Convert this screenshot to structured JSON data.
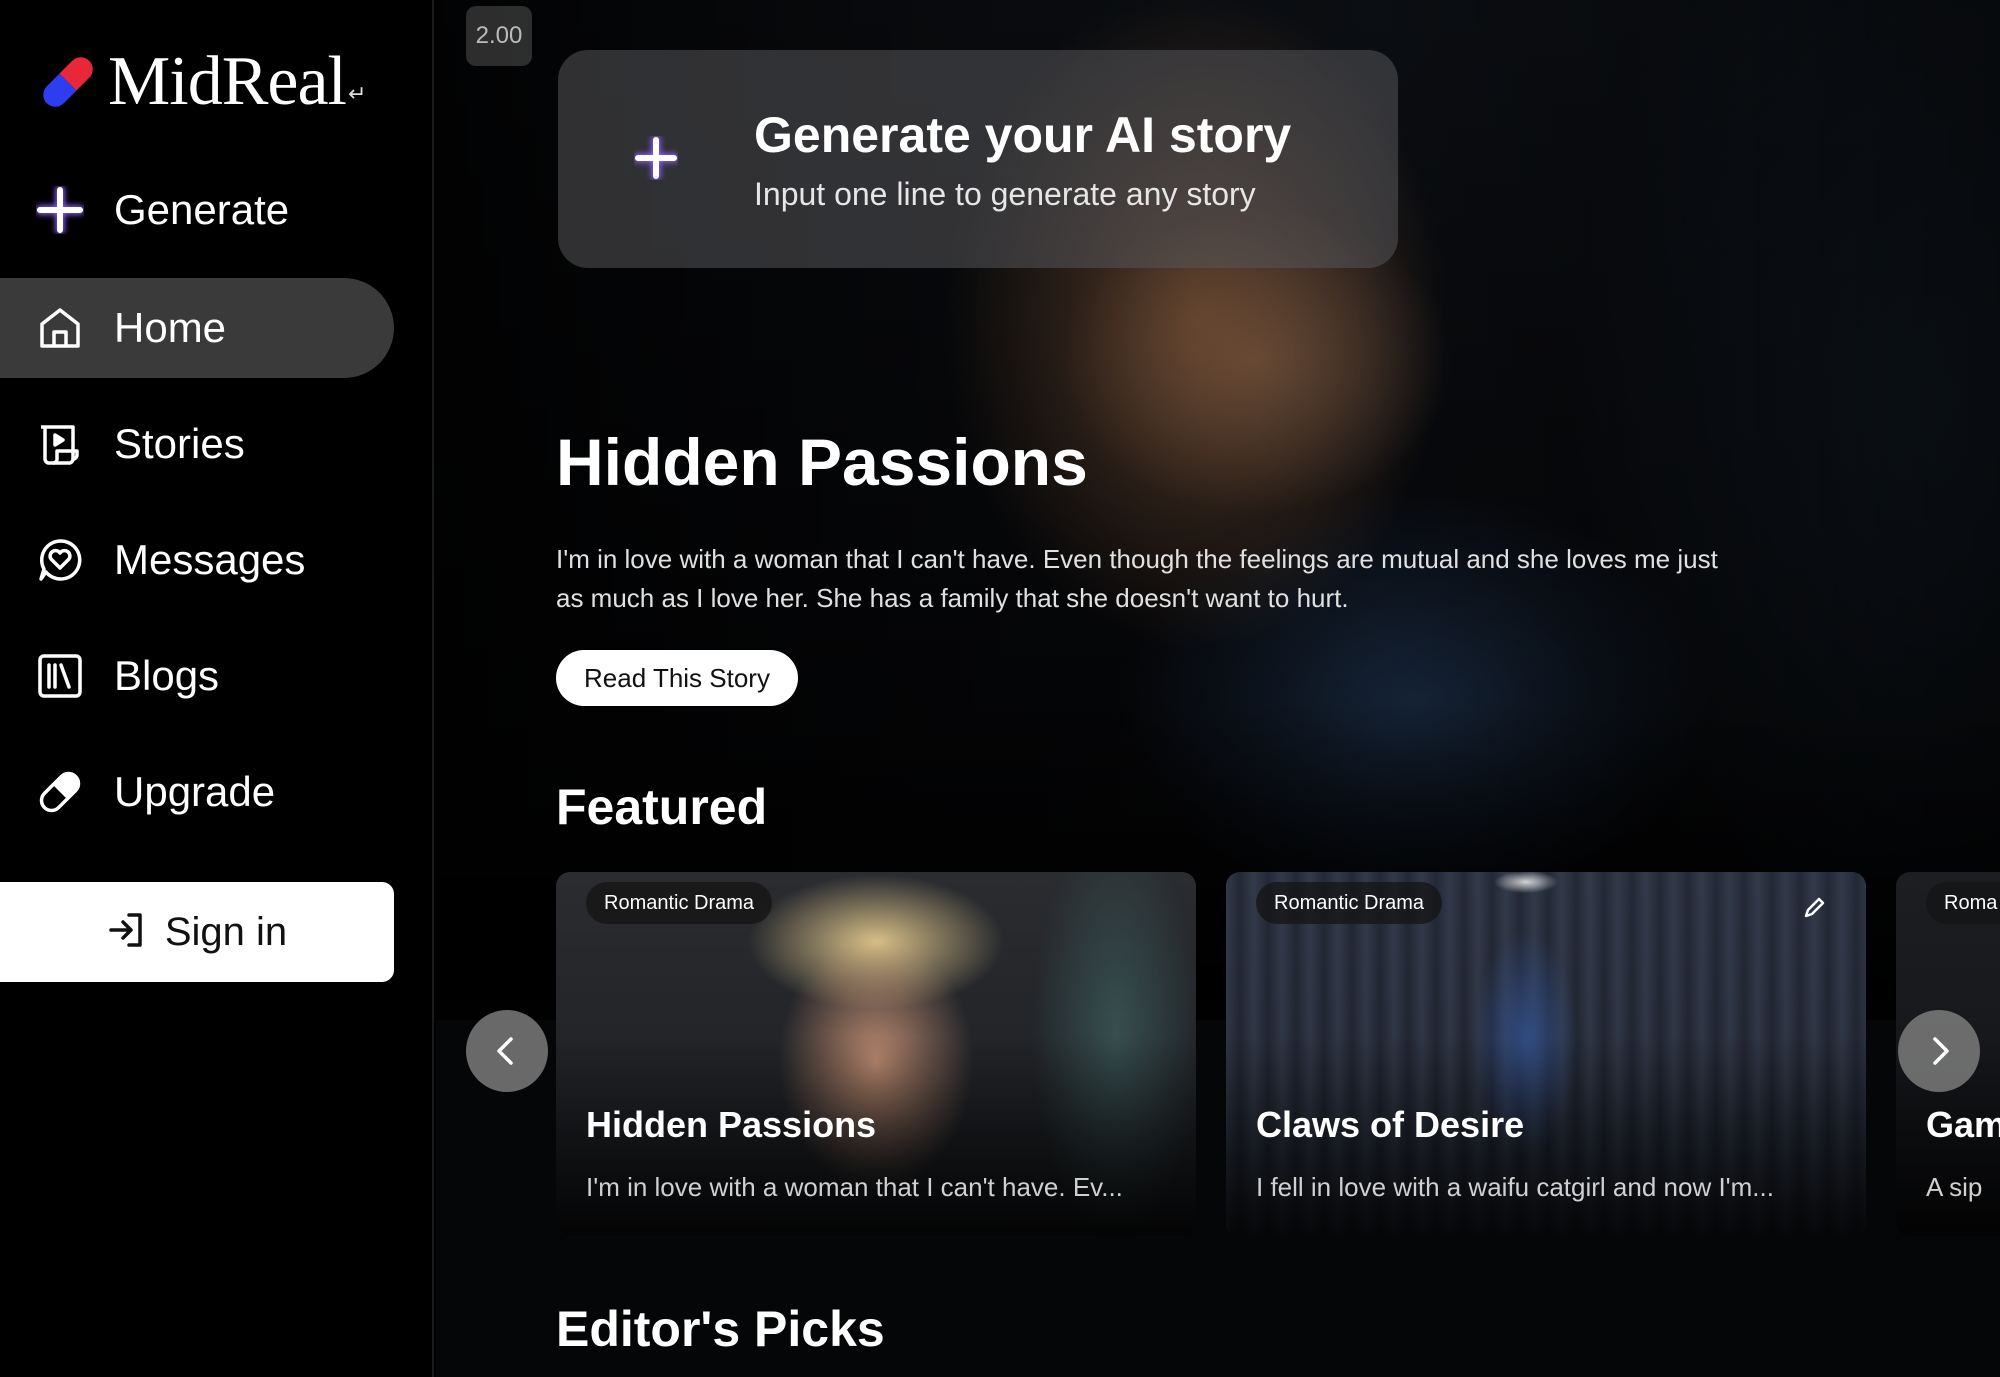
{
  "overlay": {
    "playback_speed": "2.00"
  },
  "brand": {
    "name": "MidReal",
    "mark": "↵"
  },
  "sidebar": {
    "items": [
      {
        "label": "Generate",
        "icon": "plus-icon"
      },
      {
        "label": "Home",
        "icon": "home-icon",
        "active": true
      },
      {
        "label": "Stories",
        "icon": "scroll-icon"
      },
      {
        "label": "Messages",
        "icon": "chat-heart-icon"
      },
      {
        "label": "Blogs",
        "icon": "library-icon"
      },
      {
        "label": "Upgrade",
        "icon": "pill-icon"
      }
    ],
    "signin_label": "Sign in"
  },
  "generate_card": {
    "title": "Generate your AI story",
    "subtitle": "Input one line to generate any story"
  },
  "hero": {
    "title": "Hidden Passions",
    "description": "I'm in love with a woman that I can't have. Even though the feelings are mutual and she loves me just as much as I love her. She has a family that she doesn't want to hurt.",
    "button_label": "Read This Story"
  },
  "featured": {
    "title": "Featured",
    "cards": [
      {
        "tag": "Romantic Drama",
        "title": "Hidden Passions",
        "description": "I'm in love with a woman that I can't have. Ev..."
      },
      {
        "tag": "Romantic Drama",
        "title": "Claws of Desire",
        "description": "I fell in love with a waifu catgirl and now I'm..."
      },
      {
        "tag": "Roma",
        "title": "Gam",
        "description": "A sip"
      }
    ]
  },
  "editors_picks": {
    "title": "Editor's Picks"
  },
  "colors": {
    "sidebar_bg": "#000000",
    "active_item_bg": "#3a3a3a",
    "logo_red": "#e8283a",
    "logo_blue": "#2f3df0",
    "accent_purple": "#8a5cff"
  }
}
